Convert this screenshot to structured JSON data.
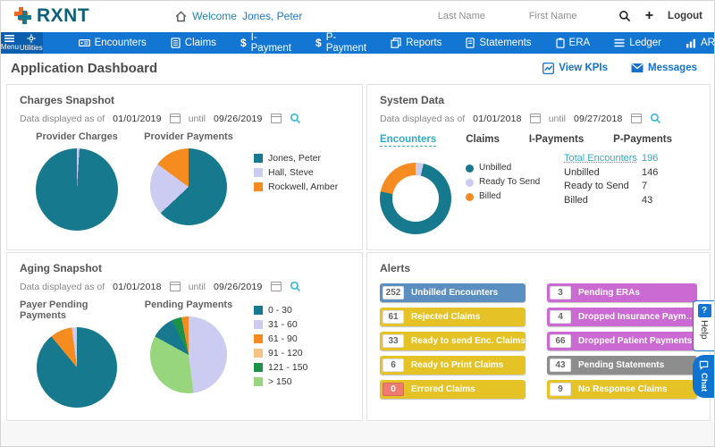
{
  "header": {
    "logo_text": "RXNT",
    "welcome_label": "Welcome",
    "user_name": "Jones, Peter",
    "last_name_placeholder": "Last Name",
    "first_name_placeholder": "First Name",
    "logout_label": "Logout"
  },
  "nav": {
    "menu_label": "Menu",
    "utilities_label": "Utilities",
    "items": [
      {
        "label": "Encounters"
      },
      {
        "label": "Claims"
      },
      {
        "label": "I-Payment"
      },
      {
        "label": "P-Payment"
      },
      {
        "label": "Reports"
      },
      {
        "label": "Statements"
      },
      {
        "label": "ERA"
      },
      {
        "label": "Ledger"
      },
      {
        "label": "AR"
      }
    ]
  },
  "page": {
    "title": "Application Dashboard",
    "view_kpis_label": "View KPIs",
    "messages_label": "Messages"
  },
  "charges_snapshot": {
    "title": "Charges Snapshot",
    "date_label": "Data displayed as of",
    "from_date": "01/01/2019",
    "until_label": "until",
    "to_date": "09/26/2019",
    "legend": [
      {
        "label": "Jones, Peter",
        "color": "#17798e"
      },
      {
        "label": "Hall, Steve",
        "color": "#ccccf2"
      },
      {
        "label": "Rockwell, Amber",
        "color": "#f68b1f"
      }
    ]
  },
  "system_data": {
    "title": "System Data",
    "date_label": "Data displayed as of",
    "from_date": "01/01/2018",
    "until_label": "until",
    "to_date": "09/27/2018",
    "tabs": [
      {
        "label": "Encounters",
        "active": true
      },
      {
        "label": "Claims",
        "active": false
      },
      {
        "label": "I-Payments",
        "active": false
      },
      {
        "label": "P-Payments",
        "active": false
      }
    ],
    "legend": [
      {
        "label": "Unbilled",
        "color": "#17798e"
      },
      {
        "label": "Ready To Send",
        "color": "#ccccf2"
      },
      {
        "label": "Billed",
        "color": "#f68b1f"
      }
    ],
    "stats": [
      {
        "label": "Total Encounters",
        "value": "196",
        "highlight": true
      },
      {
        "label": "Unbilled",
        "value": "146",
        "highlight": false
      },
      {
        "label": "Ready to Send",
        "value": "7",
        "highlight": false
      },
      {
        "label": "Billed",
        "value": "43",
        "highlight": false
      }
    ]
  },
  "aging_snapshot": {
    "title": "Aging Snapshot",
    "date_label": "Data displayed as of",
    "from_date": "01/01/2018",
    "until_label": "until",
    "to_date": "09/26/2019",
    "legend": [
      {
        "label": "0 - 30",
        "color": "#17798e"
      },
      {
        "label": "31 - 60",
        "color": "#ccccf2"
      },
      {
        "label": "61 - 90",
        "color": "#f68b1f"
      },
      {
        "label": "91 - 120",
        "color": "#f6c487"
      },
      {
        "label": "121 - 150",
        "color": "#1e9148"
      },
      {
        "label": "> 150",
        "color": "#97d67c"
      }
    ]
  },
  "alerts": {
    "title": "Alerts",
    "left": [
      {
        "count": "252",
        "label": "Unbilled Encounters",
        "color": "blue"
      },
      {
        "count": "61",
        "label": "Rejected Claims",
        "color": "yellow"
      },
      {
        "count": "33",
        "label": "Ready to send Enc. Claims",
        "color": "yellow"
      },
      {
        "count": "6",
        "label": "Ready to Print Claims",
        "color": "yellow"
      },
      {
        "count": "0",
        "label": "Errored Claims",
        "color": "yellow",
        "count_color": "red"
      }
    ],
    "right": [
      {
        "count": "3",
        "label": "Pending ERAs",
        "color": "orchid"
      },
      {
        "count": "4",
        "label": "Dropped Insurance Payments",
        "color": "orchid"
      },
      {
        "count": "66",
        "label": "Dropped Patient Payments",
        "color": "orchid"
      },
      {
        "count": "43",
        "label": "Pending Statements",
        "color": "gray"
      },
      {
        "count": "9",
        "label": "No Response Claims",
        "color": "yellow"
      }
    ]
  },
  "side_tabs": {
    "help_icon": "?",
    "help_label": "Help",
    "chat_label": "Chat"
  },
  "chart_data": [
    {
      "type": "pie",
      "title": "Provider Charges",
      "series": [
        {
          "name": "Hall, Steve",
          "value": 1,
          "color": "#ccccf2"
        },
        {
          "name": "Jones, Peter",
          "value": 99,
          "color": "#17798e"
        },
        {
          "name": "Rockwell, Amber",
          "value": 0,
          "color": "#f68b1f"
        }
      ]
    },
    {
      "type": "pie",
      "title": "Provider Payments",
      "series": [
        {
          "name": "Jones, Peter",
          "value": 63,
          "color": "#17798e"
        },
        {
          "name": "Hall, Steve",
          "value": 22,
          "color": "#ccccf2"
        },
        {
          "name": "Rockwell, Amber",
          "value": 15,
          "color": "#f68b1f"
        }
      ]
    },
    {
      "type": "donut",
      "title": "Encounters",
      "total_label": "Total Encounters",
      "total": 196,
      "series": [
        {
          "name": "Ready To Send",
          "value": 7,
          "color": "#ccccf2"
        },
        {
          "name": "Unbilled",
          "value": 146,
          "color": "#17798e"
        },
        {
          "name": "Billed",
          "value": 43,
          "color": "#f68b1f"
        }
      ]
    },
    {
      "type": "pie",
      "title": "Payer Pending Payments",
      "series": [
        {
          "name": "0 - 30",
          "value": 89,
          "color": "#17798e"
        },
        {
          "name": "61 - 90",
          "value": 9,
          "color": "#f68b1f"
        },
        {
          "name": "31 - 60",
          "value": 2,
          "color": "#ccccf2"
        }
      ]
    },
    {
      "type": "pie",
      "title": "Pending Payments",
      "series": [
        {
          "name": "31 - 60",
          "value": 48,
          "color": "#ccccf2"
        },
        {
          "name": "> 150",
          "value": 35,
          "color": "#97d67c"
        },
        {
          "name": "0 - 30",
          "value": 10,
          "color": "#17798e"
        },
        {
          "name": "121 - 150",
          "value": 4,
          "color": "#1e9148"
        },
        {
          "name": "61 - 90",
          "value": 3,
          "color": "#f68b1f"
        }
      ]
    }
  ]
}
